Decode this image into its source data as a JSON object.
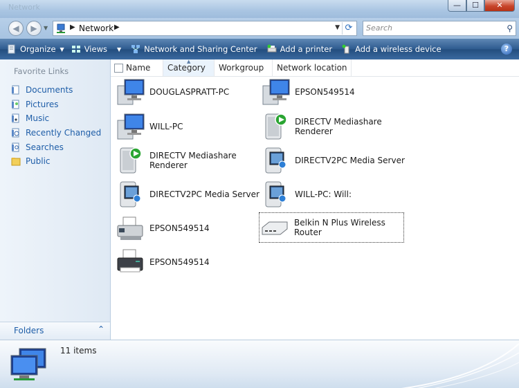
{
  "window": {
    "title": "Network",
    "controls": {
      "minimize": "—",
      "maximize": "☐",
      "close": "✕"
    }
  },
  "address": {
    "location": "Network",
    "search_placeholder": "Search"
  },
  "toolbar": {
    "items": [
      {
        "label": "Organize",
        "icon": "organize-icon",
        "dropdown": true
      },
      {
        "label": "Views",
        "icon": "views-icon",
        "dropdown": true
      },
      {
        "label": "Network and Sharing Center",
        "icon": "network-center-icon"
      },
      {
        "label": "Add a printer",
        "icon": "printer-add-icon"
      },
      {
        "label": "Add a wireless device",
        "icon": "wireless-add-icon"
      }
    ],
    "help": "?"
  },
  "sidebar": {
    "title": "Favorite Links",
    "items": [
      {
        "label": "Documents",
        "icon": "documents-icon"
      },
      {
        "label": "Pictures",
        "icon": "pictures-icon"
      },
      {
        "label": "Music",
        "icon": "music-icon"
      },
      {
        "label": "Recently Changed",
        "icon": "recent-icon"
      },
      {
        "label": "Searches",
        "icon": "searches-icon"
      },
      {
        "label": "Public",
        "icon": "public-folder-icon"
      }
    ],
    "folders_label": "Folders"
  },
  "columns": [
    "Name",
    "Category",
    "Workgroup",
    "Network location"
  ],
  "items": [
    {
      "label": "DOUGLASPRATT-PC",
      "icon": "computer-icon"
    },
    {
      "label": "EPSON549514",
      "icon": "computer-icon"
    },
    {
      "label": "WILL-PC",
      "icon": "computer-icon"
    },
    {
      "label": "DIRECTV Mediashare Renderer",
      "icon": "media-renderer-icon"
    },
    {
      "label": "DIRECTV Mediashare Renderer",
      "icon": "media-renderer-icon"
    },
    {
      "label": "DIRECTV2PC Media Server",
      "icon": "media-server-icon"
    },
    {
      "label": "DIRECTV2PC Media Server",
      "icon": "media-server-icon"
    },
    {
      "label": "WILL-PC: Will:",
      "icon": "media-server-icon"
    },
    {
      "label": "EPSON549514",
      "icon": "fax-printer-icon"
    },
    {
      "label": "Belkin N Plus Wireless Router",
      "icon": "router-icon"
    },
    {
      "label": "EPSON549514",
      "icon": "printer-icon"
    }
  ],
  "details": {
    "count": "11 items"
  },
  "colors": {
    "toolbar": "#2e5b8f",
    "link": "#1f5ea8",
    "close": "#c8452b"
  }
}
